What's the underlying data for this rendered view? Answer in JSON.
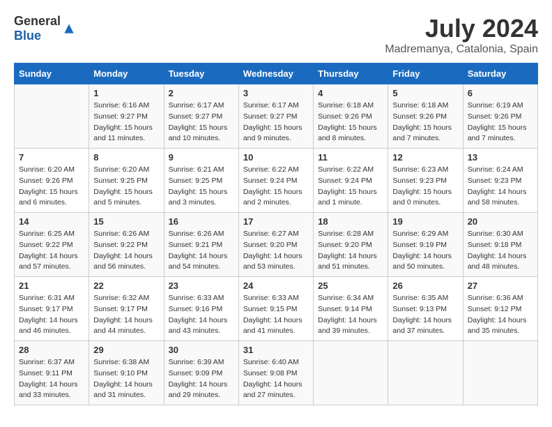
{
  "header": {
    "logo_general": "General",
    "logo_blue": "Blue",
    "month": "July 2024",
    "location": "Madremanya, Catalonia, Spain"
  },
  "columns": [
    "Sunday",
    "Monday",
    "Tuesday",
    "Wednesday",
    "Thursday",
    "Friday",
    "Saturday"
  ],
  "weeks": [
    [
      {
        "day": "",
        "info": ""
      },
      {
        "day": "1",
        "info": "Sunrise: 6:16 AM\nSunset: 9:27 PM\nDaylight: 15 hours\nand 11 minutes."
      },
      {
        "day": "2",
        "info": "Sunrise: 6:17 AM\nSunset: 9:27 PM\nDaylight: 15 hours\nand 10 minutes."
      },
      {
        "day": "3",
        "info": "Sunrise: 6:17 AM\nSunset: 9:27 PM\nDaylight: 15 hours\nand 9 minutes."
      },
      {
        "day": "4",
        "info": "Sunrise: 6:18 AM\nSunset: 9:26 PM\nDaylight: 15 hours\nand 8 minutes."
      },
      {
        "day": "5",
        "info": "Sunrise: 6:18 AM\nSunset: 9:26 PM\nDaylight: 15 hours\nand 7 minutes."
      },
      {
        "day": "6",
        "info": "Sunrise: 6:19 AM\nSunset: 9:26 PM\nDaylight: 15 hours\nand 7 minutes."
      }
    ],
    [
      {
        "day": "7",
        "info": "Sunrise: 6:20 AM\nSunset: 9:26 PM\nDaylight: 15 hours\nand 6 minutes."
      },
      {
        "day": "8",
        "info": "Sunrise: 6:20 AM\nSunset: 9:25 PM\nDaylight: 15 hours\nand 5 minutes."
      },
      {
        "day": "9",
        "info": "Sunrise: 6:21 AM\nSunset: 9:25 PM\nDaylight: 15 hours\nand 3 minutes."
      },
      {
        "day": "10",
        "info": "Sunrise: 6:22 AM\nSunset: 9:24 PM\nDaylight: 15 hours\nand 2 minutes."
      },
      {
        "day": "11",
        "info": "Sunrise: 6:22 AM\nSunset: 9:24 PM\nDaylight: 15 hours\nand 1 minute."
      },
      {
        "day": "12",
        "info": "Sunrise: 6:23 AM\nSunset: 9:23 PM\nDaylight: 15 hours\nand 0 minutes."
      },
      {
        "day": "13",
        "info": "Sunrise: 6:24 AM\nSunset: 9:23 PM\nDaylight: 14 hours\nand 58 minutes."
      }
    ],
    [
      {
        "day": "14",
        "info": "Sunrise: 6:25 AM\nSunset: 9:22 PM\nDaylight: 14 hours\nand 57 minutes."
      },
      {
        "day": "15",
        "info": "Sunrise: 6:26 AM\nSunset: 9:22 PM\nDaylight: 14 hours\nand 56 minutes."
      },
      {
        "day": "16",
        "info": "Sunrise: 6:26 AM\nSunset: 9:21 PM\nDaylight: 14 hours\nand 54 minutes."
      },
      {
        "day": "17",
        "info": "Sunrise: 6:27 AM\nSunset: 9:20 PM\nDaylight: 14 hours\nand 53 minutes."
      },
      {
        "day": "18",
        "info": "Sunrise: 6:28 AM\nSunset: 9:20 PM\nDaylight: 14 hours\nand 51 minutes."
      },
      {
        "day": "19",
        "info": "Sunrise: 6:29 AM\nSunset: 9:19 PM\nDaylight: 14 hours\nand 50 minutes."
      },
      {
        "day": "20",
        "info": "Sunrise: 6:30 AM\nSunset: 9:18 PM\nDaylight: 14 hours\nand 48 minutes."
      }
    ],
    [
      {
        "day": "21",
        "info": "Sunrise: 6:31 AM\nSunset: 9:17 PM\nDaylight: 14 hours\nand 46 minutes."
      },
      {
        "day": "22",
        "info": "Sunrise: 6:32 AM\nSunset: 9:17 PM\nDaylight: 14 hours\nand 44 minutes."
      },
      {
        "day": "23",
        "info": "Sunrise: 6:33 AM\nSunset: 9:16 PM\nDaylight: 14 hours\nand 43 minutes."
      },
      {
        "day": "24",
        "info": "Sunrise: 6:33 AM\nSunset: 9:15 PM\nDaylight: 14 hours\nand 41 minutes."
      },
      {
        "day": "25",
        "info": "Sunrise: 6:34 AM\nSunset: 9:14 PM\nDaylight: 14 hours\nand 39 minutes."
      },
      {
        "day": "26",
        "info": "Sunrise: 6:35 AM\nSunset: 9:13 PM\nDaylight: 14 hours\nand 37 minutes."
      },
      {
        "day": "27",
        "info": "Sunrise: 6:36 AM\nSunset: 9:12 PM\nDaylight: 14 hours\nand 35 minutes."
      }
    ],
    [
      {
        "day": "28",
        "info": "Sunrise: 6:37 AM\nSunset: 9:11 PM\nDaylight: 14 hours\nand 33 minutes."
      },
      {
        "day": "29",
        "info": "Sunrise: 6:38 AM\nSunset: 9:10 PM\nDaylight: 14 hours\nand 31 minutes."
      },
      {
        "day": "30",
        "info": "Sunrise: 6:39 AM\nSunset: 9:09 PM\nDaylight: 14 hours\nand 29 minutes."
      },
      {
        "day": "31",
        "info": "Sunrise: 6:40 AM\nSunset: 9:08 PM\nDaylight: 14 hours\nand 27 minutes."
      },
      {
        "day": "",
        "info": ""
      },
      {
        "day": "",
        "info": ""
      },
      {
        "day": "",
        "info": ""
      }
    ]
  ]
}
